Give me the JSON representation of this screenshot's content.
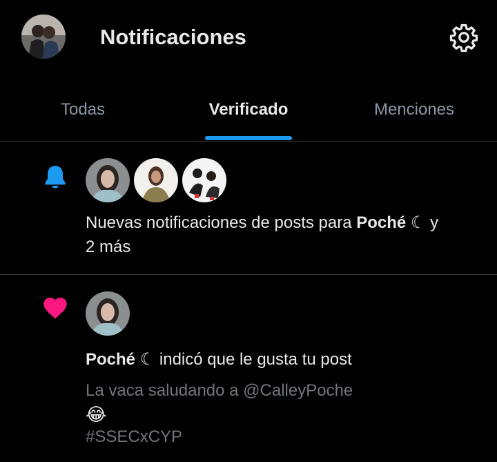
{
  "header": {
    "title": "Notificaciones",
    "avatar_icon": "profile-avatar",
    "settings_icon": "gear-icon"
  },
  "tabs": [
    {
      "label": "Todas",
      "active": false
    },
    {
      "label": "Verificado",
      "active": true
    },
    {
      "label": "Menciones",
      "active": false
    }
  ],
  "notifications": [
    {
      "icon": "bell-icon",
      "icon_color": "#1d9bf0",
      "avatars": [
        "avatar-poche",
        "avatar-user-2",
        "avatar-user-3"
      ],
      "user": "Poché",
      "text_before": "Nuevas notificaciones de posts para ",
      "text_after": " y",
      "text_line2": "2 más"
    },
    {
      "icon": "heart-icon",
      "icon_color": "#f91880",
      "avatars": [
        "avatar-poche"
      ],
      "user": "Poché",
      "text_after": " indicó que le gusta tu post",
      "post_text": "La vaca saludando a @CalleyPoche",
      "emoji": "😂",
      "hashtag": "#SSECxCYP"
    }
  ],
  "colors": {
    "background": "#000000",
    "accent": "#1d9bf0",
    "like": "#f91880",
    "muted": "#71767b"
  }
}
